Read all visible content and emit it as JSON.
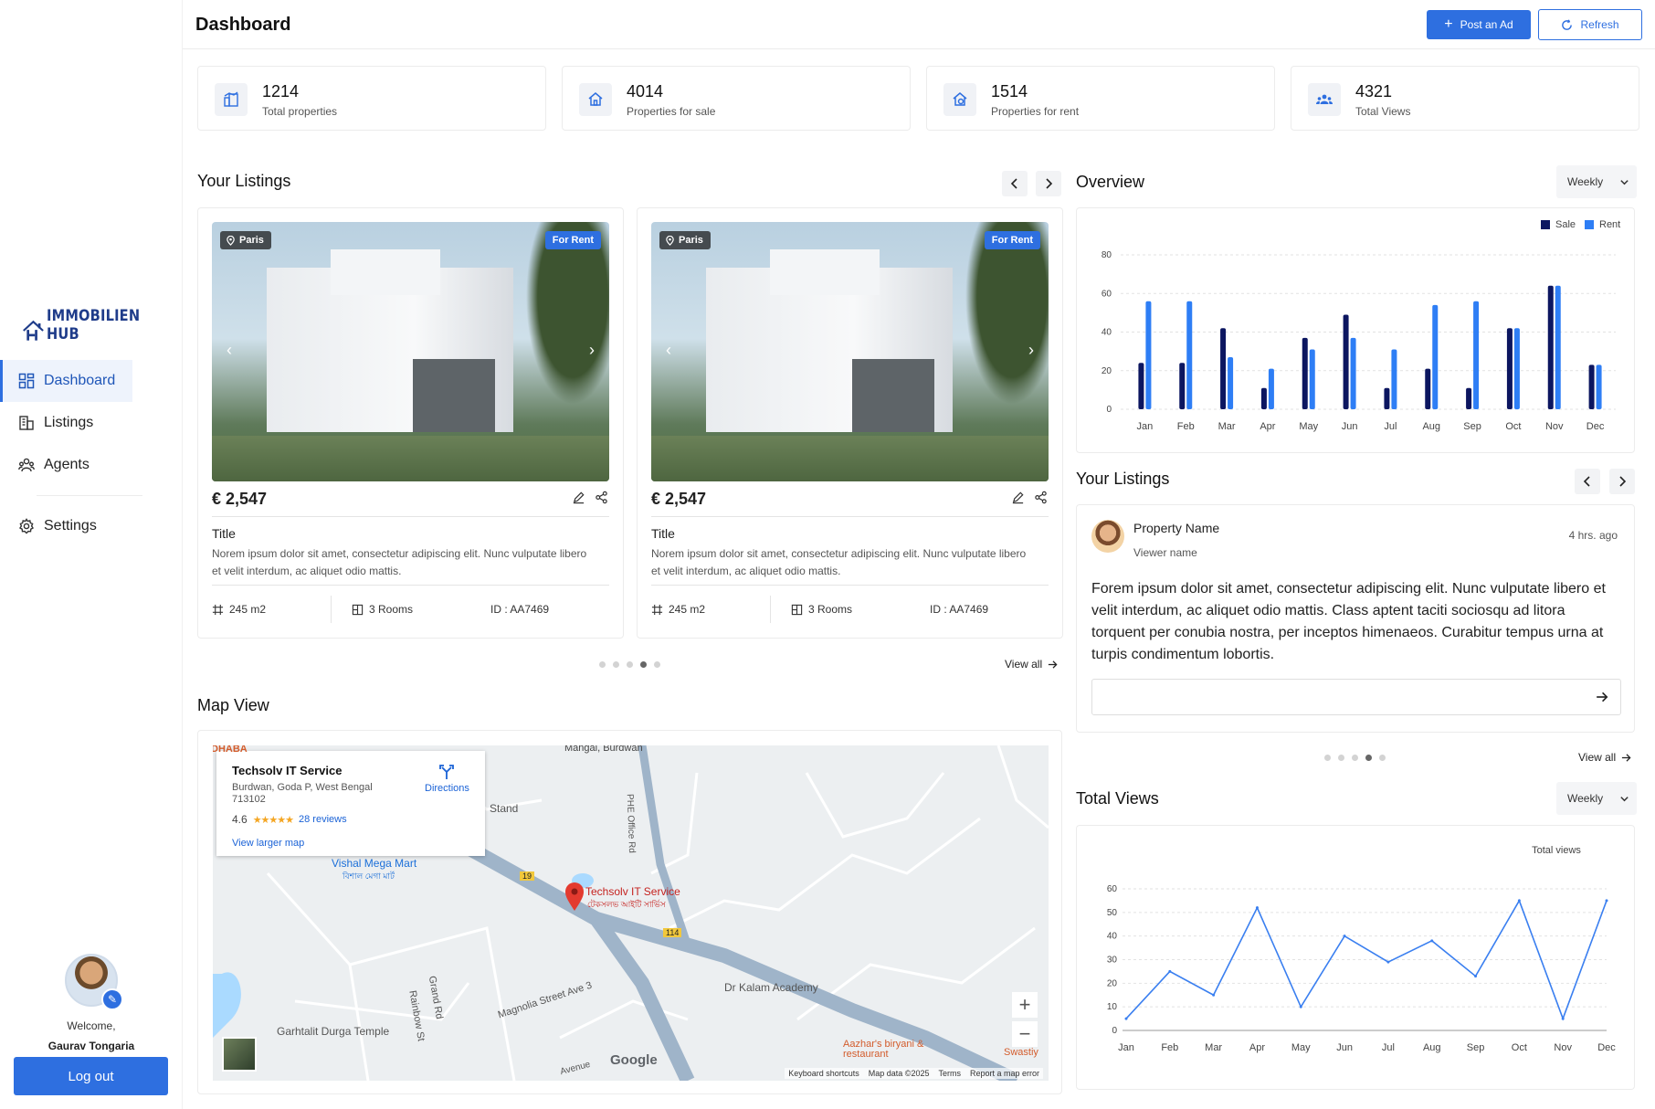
{
  "brand": {
    "name": "IMMOBILIEN HUB"
  },
  "header": {
    "title": "Dashboard",
    "post_label": "Post an Ad",
    "refresh_label": "Refresh"
  },
  "sidebar": {
    "items": [
      {
        "label": "Dashboard",
        "icon": "dashboard-icon",
        "active": true
      },
      {
        "label": "Listings",
        "icon": "building-icon"
      },
      {
        "label": "Agents",
        "icon": "agents-icon"
      },
      {
        "label": "Settings",
        "icon": "gear-icon"
      }
    ],
    "welcome": "Welcome,",
    "username": "Gaurav Tongaria",
    "logout_label": "Log out"
  },
  "stats": [
    {
      "value": "1214",
      "label": "Total properties",
      "icon": "chart-building-icon"
    },
    {
      "value": "4014",
      "label": "Properties for sale",
      "icon": "home-icon"
    },
    {
      "value": "1514",
      "label": "Properties for rent",
      "icon": "rent-home-icon"
    },
    {
      "value": "4321",
      "label": "Total Views",
      "icon": "people-icon"
    }
  ],
  "listings": {
    "title": "Your Listings",
    "view_all": "View all",
    "cards": [
      {
        "location": "Paris",
        "badge": "For Rent",
        "price": "€ 2,547",
        "title": "Title",
        "description": "Norem ipsum dolor sit amet, consectetur adipiscing elit. Nunc vulputate libero et velit interdum, ac aliquet odio mattis.",
        "area": "245 m2",
        "rooms": "3 Rooms",
        "id": "ID : AA7469"
      },
      {
        "location": "Paris",
        "badge": "For Rent",
        "price": "€ 2,547",
        "title": "Title",
        "description": "Norem ipsum dolor sit amet, consectetur adipiscing elit. Nunc vulputate libero et velit interdum, ac aliquet odio mattis.",
        "area": "245 m2",
        "rooms": "3 Rooms",
        "id": "ID : AA7469"
      }
    ],
    "dots": 5,
    "active_dot": 3
  },
  "map": {
    "title": "Map View",
    "info": {
      "name": "Techsolv IT Service",
      "address": "Burdwan, Goda P, West Bengal 713102",
      "rating": "4.6",
      "stars": "★★★★★",
      "reviews": "28 reviews",
      "larger_map": "View larger map",
      "directions": "Directions"
    },
    "labels": {
      "pin": "Techsolv IT Service",
      "pin_sub": "টেকসলভ আইটি সার্ভিস",
      "mart": "Vishal Mega Mart",
      "mart_sub": "বিশাল মেগা মার্ট",
      "stand": "Stand",
      "manglar": "Mangal, Burdwan",
      "dhaba": "DHABA",
      "academy": "Dr Kalam Academy",
      "temple": "Garhtalit Durga Temple",
      "magnolia": "Magnolia Street Ave 3",
      "rainbow": "Rainbow St",
      "grand": "Grand Rd",
      "phe": "PHE Office Rd",
      "biryani": "Aazhar's biryani & restaurant",
      "swastiy": "Swastiy",
      "avenue": "Avenue",
      "google": "Google",
      "r114": "114",
      "r19": "19"
    },
    "footer": [
      "Keyboard shortcuts",
      "Map data ©2025",
      "Terms",
      "Report a map error"
    ],
    "zoom_in": "+",
    "zoom_out": "−"
  },
  "overview": {
    "title": "Overview",
    "period": "Weekly"
  },
  "chart_data": [
    {
      "type": "bar",
      "title": "",
      "categories": [
        "Jan",
        "Feb",
        "Mar",
        "Apr",
        "May",
        "Jun",
        "Jul",
        "Aug",
        "Sep",
        "Oct",
        "Nov",
        "Dec"
      ],
      "series": [
        {
          "name": "Sale",
          "color": "#0c1660",
          "values": [
            24,
            24,
            42,
            11,
            37,
            49,
            11,
            21,
            11,
            42,
            64,
            23
          ]
        },
        {
          "name": "Rent",
          "color": "#2e7ef5",
          "values": [
            56,
            56,
            27,
            21,
            31,
            37,
            31,
            54,
            56,
            42,
            64,
            23
          ]
        }
      ],
      "ylim": [
        0,
        80
      ],
      "yticks": [
        0,
        20,
        40,
        60,
        80
      ],
      "grid": true,
      "legend": "top-right"
    },
    {
      "type": "line",
      "title": "",
      "categories": [
        "Jan",
        "Feb",
        "Mar",
        "Apr",
        "May",
        "Jun",
        "Jul",
        "Aug",
        "Sep",
        "Oct",
        "Nov",
        "Dec"
      ],
      "series": [
        {
          "name": "Total views",
          "color": "#3a7ff0",
          "values": [
            5,
            25,
            15,
            52,
            10,
            40,
            29,
            38,
            23,
            55,
            5,
            55
          ]
        }
      ],
      "ylim": [
        0,
        60
      ],
      "yticks": [
        0,
        10,
        20,
        30,
        40,
        50,
        60
      ],
      "grid": true,
      "legend": "top-right"
    }
  ],
  "reviews": {
    "title": "Your Listings",
    "property_name": "Property Name",
    "viewer": "Viewer name",
    "time": "4 hrs. ago",
    "text": "Forem ipsum dolor sit amet, consectetur adipiscing elit. Nunc vulputate libero et velit interdum, ac aliquet odio mattis. Class aptent taciti sociosqu ad litora torquent per conubia nostra, per inceptos himenaeos. Curabitur tempus urna at turpis condimentum lobortis.",
    "view_all": "View all",
    "dots": 5,
    "active_dot": 3
  },
  "total_views": {
    "title": "Total Views",
    "period": "Weekly",
    "legend": "Total views"
  },
  "colors": {
    "accent": "#2e6fe0",
    "sale": "#0c1660",
    "rent": "#2e7ef5"
  }
}
